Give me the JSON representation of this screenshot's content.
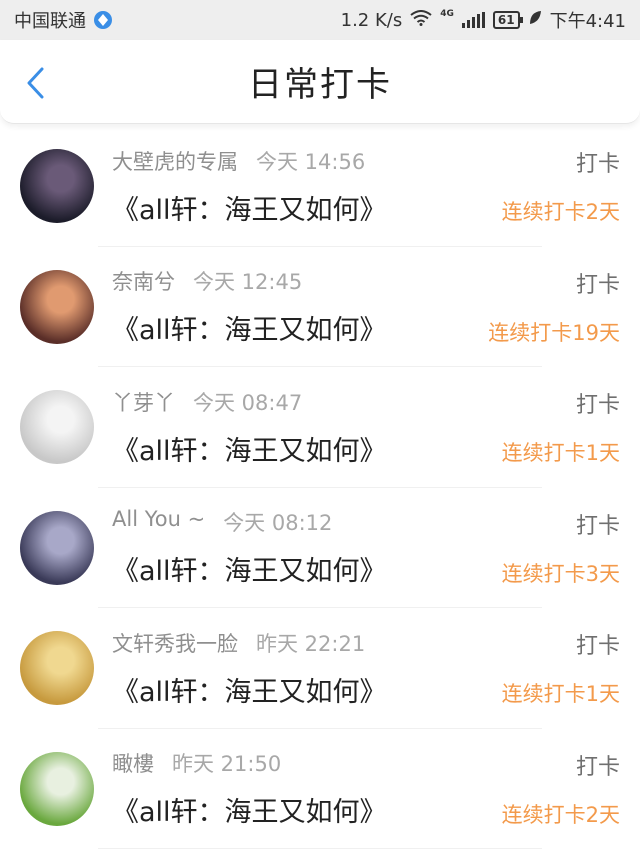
{
  "status_bar": {
    "carrier": "中国联通",
    "speed": "1.2 K/s",
    "network": "4G",
    "battery": "61",
    "time": "下午4:41"
  },
  "header": {
    "title": "日常打卡"
  },
  "feed": [
    {
      "name": "大壁虎的专属",
      "time": "今天 14:56",
      "topic": "《all轩：海王又如何》",
      "action": "打卡",
      "streak": "连续打卡2天",
      "avatar_colors": [
        "#1c1c2a",
        "#6a5a78"
      ]
    },
    {
      "name": "奈南兮",
      "time": "今天 12:45",
      "topic": "《all轩：海王又如何》",
      "action": "打卡",
      "streak": "连续打卡19天",
      "avatar_colors": [
        "#5a2e28",
        "#e09a70"
      ]
    },
    {
      "name": "丫芽丫",
      "time": "今天 08:47",
      "topic": "《all轩：海王又如何》",
      "action": "打卡",
      "streak": "连续打卡1天",
      "avatar_colors": [
        "#c8c8c8",
        "#f4f4f4"
      ]
    },
    {
      "name": "All You ~",
      "time": "今天 08:12",
      "topic": "《all轩：海王又如何》",
      "action": "打卡",
      "streak": "连续打卡3天",
      "avatar_colors": [
        "#3a3a58",
        "#a8a8c8"
      ]
    },
    {
      "name": "文轩秀我一脸",
      "time": "昨天 22:21",
      "topic": "《all轩：海王又如何》",
      "action": "打卡",
      "streak": "连续打卡1天",
      "avatar_colors": [
        "#c79a3e",
        "#f0d890"
      ]
    },
    {
      "name": "瞰樓",
      "time": "昨天 21:50",
      "topic": "《all轩：海王又如何》",
      "action": "打卡",
      "streak": "连续打卡2天",
      "avatar_colors": [
        "#6aa83e",
        "#e8f0e0"
      ]
    }
  ],
  "colors": {
    "accent": "#3a8ee6",
    "streak": "#f39a4b"
  }
}
